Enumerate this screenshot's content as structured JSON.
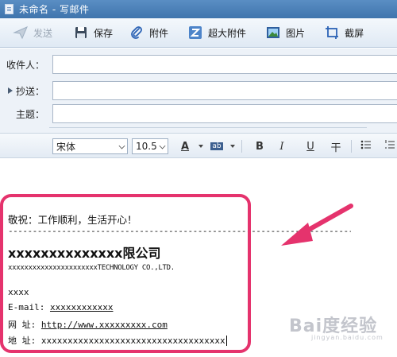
{
  "window": {
    "title": "未命名 - 写邮件"
  },
  "toolbar": {
    "send": "发送",
    "save": "保存",
    "attach": "附件",
    "super_attach": "超大附件",
    "image": "图片",
    "screenshot": "截屏"
  },
  "fields": {
    "to_label": "收件人：",
    "cc_label": "抄送：",
    "subject_label": "主题："
  },
  "format": {
    "font": "宋体",
    "size": "10.5",
    "font_color_glyph": "A",
    "bg_color_glyph": "ab",
    "bold": "B",
    "italic": "I",
    "underline": "U",
    "strike": "干"
  },
  "signature": {
    "greeting": "敬祝：工作顺利，生活开心！",
    "dashes": "------------------------------------------------------------------------",
    "company_cn": "xxxxxxxxxxxxxx限公司",
    "company_en": "xxxxxxxxxxxxxxxxxxxxxxTECHNOLOGY CO.,LTD.",
    "line1": "xxxx",
    "email_label": "E-mail:",
    "email_value": "xxxxxxxxxxxx",
    "web_label": "网  址:",
    "web_value": "http://www.xxxxxxxxx.com",
    "addr_label": "地  址:",
    "addr_value": "xxxxxxxxxxxxxxxxxxxxxxxxxxxxxxxxxxx"
  },
  "watermark": {
    "main": "Bai度经验",
    "sub": "jingyan.baidu.com"
  },
  "colors": {
    "highlight": "#e5336d",
    "titlebar": "#4a80bb"
  }
}
